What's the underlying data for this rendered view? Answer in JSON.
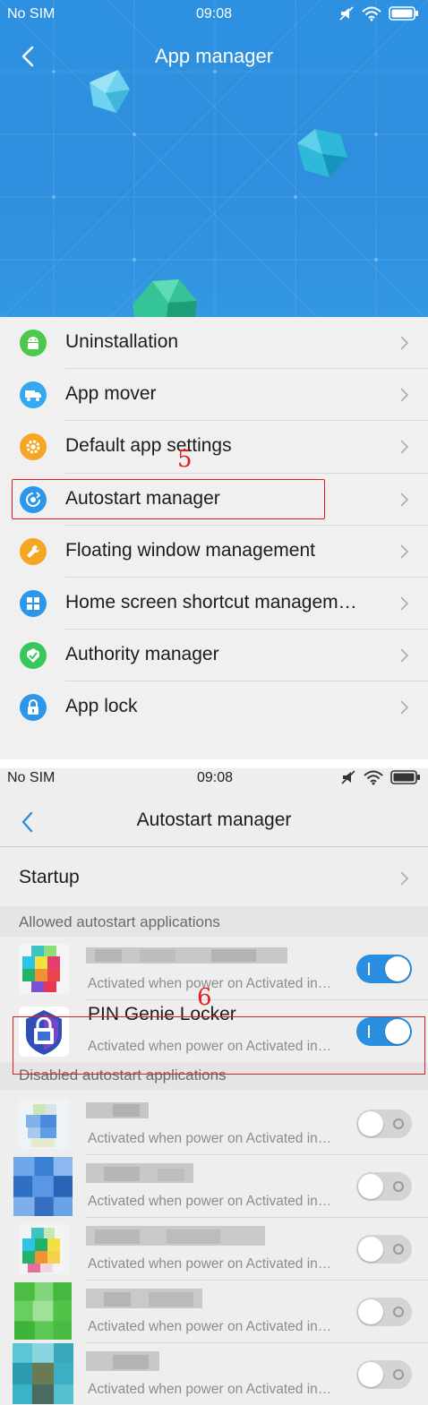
{
  "screen1": {
    "status": {
      "carrier": "No SIM",
      "time": "09:08"
    },
    "title": "App manager",
    "menu": [
      {
        "label": "Uninstallation",
        "icon": "android-icon",
        "color": "#4cc94c"
      },
      {
        "label": "App mover",
        "icon": "truck-icon",
        "color": "#34a8f0"
      },
      {
        "label": "Default app settings",
        "icon": "gear-icon",
        "color": "#f5a623"
      },
      {
        "label": "Autostart manager",
        "icon": "autostart-icon",
        "color": "#2b96ea"
      },
      {
        "label": "Floating window management",
        "icon": "wrench-icon",
        "color": "#f5a623"
      },
      {
        "label": "Home screen shortcut managem…",
        "icon": "grid-icon",
        "color": "#2b96ea"
      },
      {
        "label": "Authority manager",
        "icon": "shield-check-icon",
        "color": "#37c75a"
      },
      {
        "label": "App lock",
        "icon": "lock-icon",
        "color": "#2b96ea"
      }
    ],
    "annotation": "5"
  },
  "screen2": {
    "status": {
      "carrier": "No SIM",
      "time": "09:08"
    },
    "title": "Autostart manager",
    "startup_label": "Startup",
    "allowed_header": "Allowed autostart applications",
    "disabled_header": "Disabled autostart applications",
    "annotation": "6",
    "allowed": [
      {
        "name": "",
        "desc": "Activated when power on  Activated in…",
        "enabled": true
      },
      {
        "name": "PIN Genie Locker",
        "desc": "Activated when power on  Activated in…",
        "enabled": true
      }
    ],
    "disabled": [
      {
        "name": "",
        "desc": "Activated when power on  Activated in…",
        "enabled": false
      },
      {
        "name": "",
        "desc": "Activated when power on  Activated in…",
        "enabled": false
      },
      {
        "name": "",
        "desc": "Activated when power on  Activated in…",
        "enabled": false
      },
      {
        "name": "",
        "desc": "Activated when power on  Activated in…",
        "enabled": false
      },
      {
        "name": "",
        "desc": "Activated when power on  Activated in…",
        "enabled": false
      }
    ]
  },
  "colors": {
    "accent": "#2b8fe0",
    "annotation": "#e21b1b"
  }
}
